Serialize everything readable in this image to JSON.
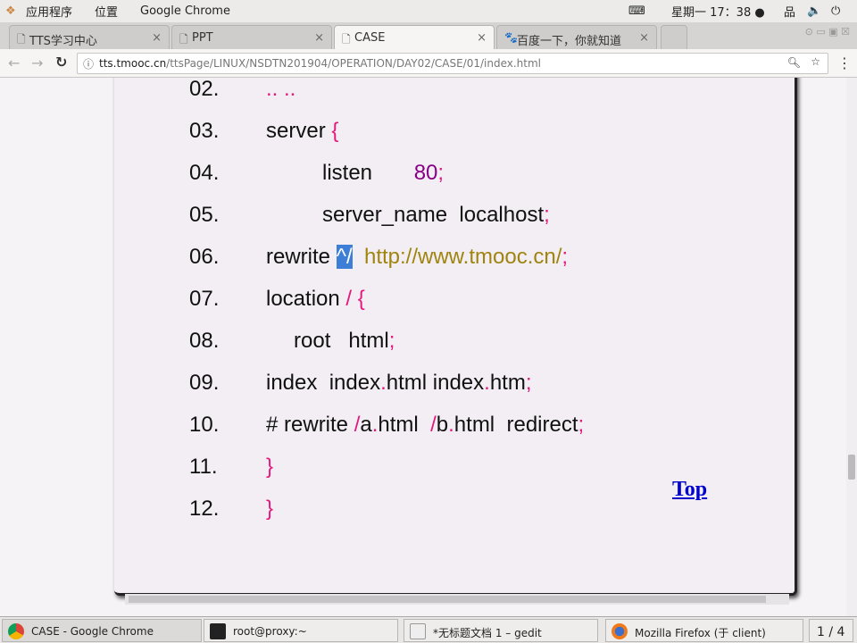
{
  "topbar": {
    "apps": "应用程序",
    "places": "位置",
    "app_name": "Google Chrome",
    "clock": "星期一 17：38 ●"
  },
  "tabs": [
    {
      "label": "TTS学习中心"
    },
    {
      "label": "PPT"
    },
    {
      "label": "CASE",
      "active": true
    },
    {
      "label": "百度一下，你就知道"
    }
  ],
  "address": {
    "host": "tts.tmooc.cn",
    "path": "/ttsPage/LINUX/NSDTN201904/OPERATION/DAY02/CASE/01/index.html"
  },
  "code_lines": [
    {
      "num": "02.",
      "indent": 0,
      "tokens": [
        {
          "t": ".. ..",
          "c": "p"
        }
      ]
    },
    {
      "num": "03.",
      "indent": 0,
      "tokens": [
        {
          "t": "server ",
          "c": ""
        },
        {
          "t": "{",
          "c": "p"
        }
      ]
    },
    {
      "num": "04.",
      "indent": 2,
      "tokens": [
        {
          "t": "listen       ",
          "c": ""
        },
        {
          "t": "80",
          "c": "n"
        },
        {
          "t": ";",
          "c": "p"
        }
      ]
    },
    {
      "num": "05.",
      "indent": 2,
      "tokens": [
        {
          "t": "server_name  localhost",
          "c": ""
        },
        {
          "t": ";",
          "c": "p"
        }
      ]
    },
    {
      "num": "06.",
      "indent": 0,
      "tokens": [
        {
          "t": "rewrite ",
          "c": ""
        },
        {
          "t": "^/",
          "c": "sel"
        },
        {
          "t": "  ",
          "c": ""
        },
        {
          "t": "http://www.tmooc.cn/",
          "c": "u"
        },
        {
          "t": ";",
          "c": "p"
        }
      ]
    },
    {
      "num": "07.",
      "indent": 0,
      "tokens": [
        {
          "t": "location ",
          "c": ""
        },
        {
          "t": "/ {",
          "c": "p"
        }
      ]
    },
    {
      "num": "08.",
      "indent": 1,
      "tokens": [
        {
          "t": "root   html",
          "c": ""
        },
        {
          "t": ";",
          "c": "p"
        }
      ]
    },
    {
      "num": "09.",
      "indent": 0,
      "tokens": [
        {
          "t": "index  index",
          "c": ""
        },
        {
          "t": ".",
          "c": "p"
        },
        {
          "t": "html index",
          "c": ""
        },
        {
          "t": ".",
          "c": "p"
        },
        {
          "t": "htm",
          "c": ""
        },
        {
          "t": ";",
          "c": "p"
        }
      ]
    },
    {
      "num": "10.",
      "indent": 0,
      "tokens": [
        {
          "t": "# rewrite ",
          "c": ""
        },
        {
          "t": "/",
          "c": "p"
        },
        {
          "t": "a",
          "c": ""
        },
        {
          "t": ".",
          "c": "p"
        },
        {
          "t": "html  ",
          "c": ""
        },
        {
          "t": "/",
          "c": "p"
        },
        {
          "t": "b",
          "c": ""
        },
        {
          "t": ".",
          "c": "p"
        },
        {
          "t": "html  redirect",
          "c": ""
        },
        {
          "t": ";",
          "c": "p"
        }
      ]
    },
    {
      "num": "11.",
      "indent": 0,
      "tokens": [
        {
          "t": "}",
          "c": "p"
        }
      ]
    },
    {
      "num": "12.",
      "indent": 0,
      "tokens": [
        {
          "t": "}",
          "c": "p"
        }
      ]
    }
  ],
  "top_link": "Top",
  "taskbar": {
    "items": [
      {
        "label": "CASE - Google Chrome"
      },
      {
        "label": "root@proxy:~"
      },
      {
        "label": "*无标题文档 1 – gedit"
      },
      {
        "label": "Mozilla Firefox (于 client)"
      }
    ],
    "workspace": "1 / 4"
  }
}
